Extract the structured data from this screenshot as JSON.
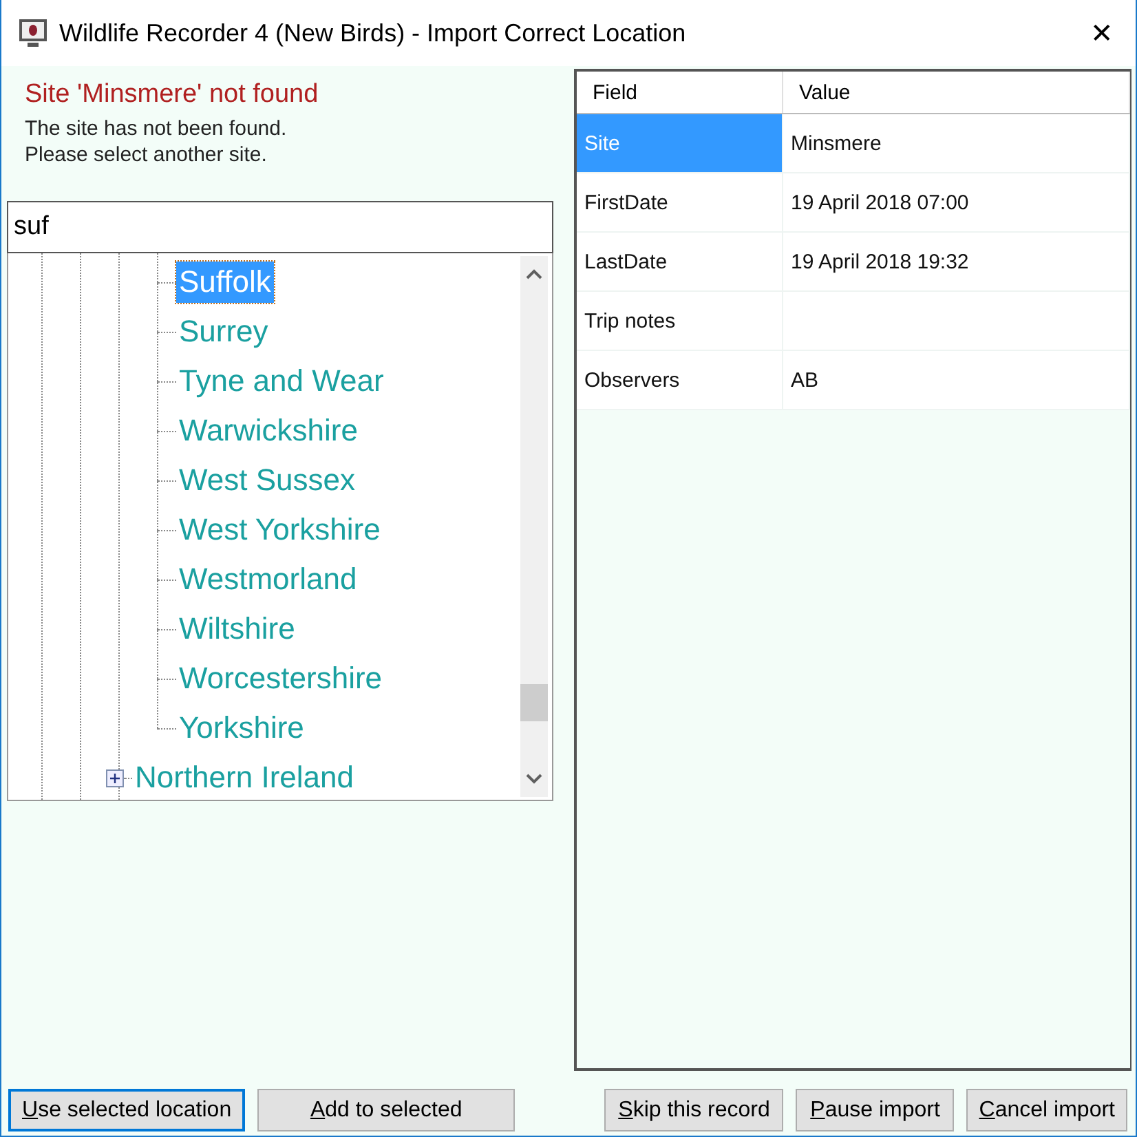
{
  "window": {
    "title": "Wildlife Recorder 4 (New Birds) - Import Correct Location",
    "close": "✕"
  },
  "message": {
    "heading": "Site 'Minsmere' not found",
    "lines": [
      "The site has not been found.",
      "Please select another site."
    ]
  },
  "search": {
    "value": "suf"
  },
  "tree": {
    "continued_children": [
      {
        "label": "Suffolk",
        "selected": true
      },
      {
        "label": "Surrey",
        "selected": false
      },
      {
        "label": "Tyne and Wear",
        "selected": false
      },
      {
        "label": "Warwickshire",
        "selected": false
      },
      {
        "label": "West Sussex",
        "selected": false
      },
      {
        "label": "West Yorkshire",
        "selected": false
      },
      {
        "label": "Westmorland",
        "selected": false
      },
      {
        "label": "Wiltshire",
        "selected": false
      },
      {
        "label": "Worcestershire",
        "selected": false
      },
      {
        "label": "Yorkshire",
        "selected": false
      }
    ],
    "items": [
      {
        "label": "Northern Ireland",
        "selected": false,
        "expanded": false
      }
    ]
  },
  "grid": {
    "columns": [
      "Field",
      "Value"
    ],
    "rows": [
      {
        "field": "Site",
        "value": "Minsmere",
        "selected": true
      },
      {
        "field": "FirstDate",
        "value": "19 April 2018 07:00",
        "selected": false
      },
      {
        "field": "LastDate",
        "value": "19 April 2018 19:32",
        "selected": false
      },
      {
        "field": "Trip notes",
        "value": "",
        "selected": false
      },
      {
        "field": "Observers",
        "value": "AB",
        "selected": false
      }
    ]
  },
  "buttons_left": [
    {
      "label": "Use selected location",
      "default": true
    },
    {
      "label": "Add to selected",
      "default": false
    }
  ],
  "buttons_right": [
    {
      "label": "Skip this record",
      "default": false
    },
    {
      "label": "Pause import",
      "default": false
    },
    {
      "label": "Cancel import",
      "default": false
    }
  ]
}
